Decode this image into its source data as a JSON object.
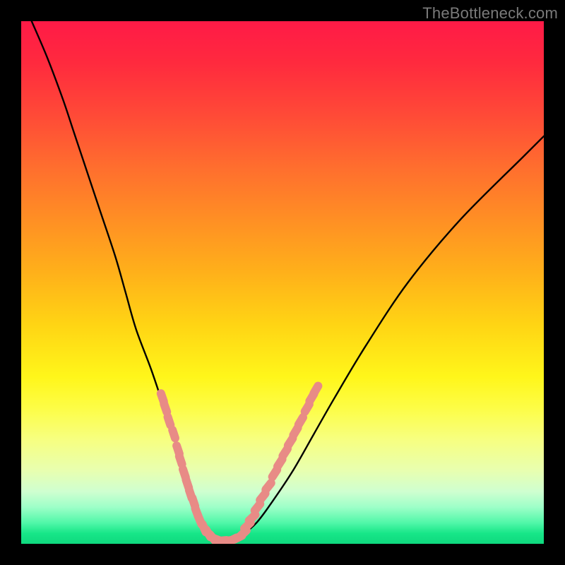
{
  "watermark": "TheBottleneck.com",
  "chart_data": {
    "type": "line",
    "title": "",
    "xlabel": "",
    "ylabel": "",
    "xlim": [
      0,
      100
    ],
    "ylim": [
      0,
      100
    ],
    "series": [
      {
        "name": "bottleneck-curve",
        "x": [
          2,
          5,
          8,
          10,
          12,
          15,
          18,
          20,
          22,
          25,
          28,
          30,
          32,
          33,
          34,
          35,
          36,
          37,
          38,
          40,
          42,
          45,
          48,
          52,
          56,
          60,
          66,
          74,
          84,
          96,
          100
        ],
        "y": [
          100,
          93,
          85,
          79,
          73,
          64,
          55,
          48,
          41,
          33,
          24,
          18,
          12,
          9,
          6,
          4,
          2,
          1,
          0.5,
          0.5,
          1.5,
          4,
          8,
          14,
          21,
          28,
          38,
          50,
          62,
          74,
          78
        ]
      }
    ],
    "markers": [
      {
        "name": "left-cluster",
        "points": [
          {
            "x": 27,
            "y": 28
          },
          {
            "x": 27.6,
            "y": 26
          },
          {
            "x": 28.3,
            "y": 23.5
          },
          {
            "x": 29.2,
            "y": 21
          },
          {
            "x": 30.0,
            "y": 18
          },
          {
            "x": 30.5,
            "y": 16
          },
          {
            "x": 31.2,
            "y": 13.5
          },
          {
            "x": 31.8,
            "y": 11.5
          },
          {
            "x": 32.4,
            "y": 9.5
          },
          {
            "x": 33.0,
            "y": 8
          },
          {
            "x": 33.6,
            "y": 6
          }
        ]
      },
      {
        "name": "bottom-cluster",
        "points": [
          {
            "x": 34.2,
            "y": 4.5
          },
          {
            "x": 35.0,
            "y": 3
          },
          {
            "x": 35.8,
            "y": 2
          },
          {
            "x": 36.6,
            "y": 1.2
          },
          {
            "x": 37.5,
            "y": 0.8
          },
          {
            "x": 38.5,
            "y": 0.6
          },
          {
            "x": 39.5,
            "y": 0.6
          },
          {
            "x": 40.5,
            "y": 0.8
          },
          {
            "x": 41.5,
            "y": 1.2
          },
          {
            "x": 42.5,
            "y": 2
          }
        ]
      },
      {
        "name": "right-cluster",
        "points": [
          {
            "x": 43.3,
            "y": 3.5
          },
          {
            "x": 44.2,
            "y": 5
          },
          {
            "x": 45.2,
            "y": 7
          },
          {
            "x": 46.2,
            "y": 9
          },
          {
            "x": 47.3,
            "y": 11
          },
          {
            "x": 48.5,
            "y": 13.5
          },
          {
            "x": 49.5,
            "y": 15.5
          },
          {
            "x": 50.5,
            "y": 17.5
          },
          {
            "x": 51.5,
            "y": 19.5
          },
          {
            "x": 52.5,
            "y": 21.5
          },
          {
            "x": 53.5,
            "y": 23.5
          },
          {
            "x": 54.7,
            "y": 26
          },
          {
            "x": 55.6,
            "y": 28
          },
          {
            "x": 56.4,
            "y": 29.5
          }
        ]
      }
    ],
    "marker_color": "#e88b86",
    "curve_color": "#000000"
  }
}
